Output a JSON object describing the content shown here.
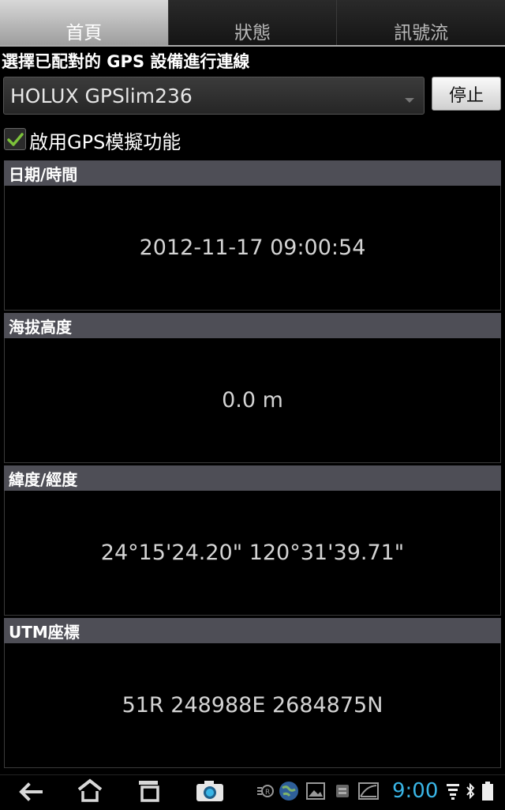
{
  "tabs": [
    {
      "label": "首頁",
      "active": true
    },
    {
      "label": "狀態",
      "active": false
    },
    {
      "label": "訊號流",
      "active": false
    }
  ],
  "connect": {
    "prompt": "選擇已配對的 GPS 設備進行連線",
    "device": "HOLUX GPSlim236",
    "stop_label": "停止"
  },
  "simulation": {
    "label": "啟用GPS模擬功能",
    "checked": true
  },
  "sections": {
    "datetime": {
      "header": "日期/時間",
      "value": "2012-11-17 09:00:54"
    },
    "altitude": {
      "header": "海拔高度",
      "value": "0.0 m"
    },
    "latlon": {
      "header": "緯度/經度",
      "value": "24°15'24.20\" 120°31'39.71\""
    },
    "utm": {
      "header": "UTM座標",
      "value": "51R 248988E 2684875N"
    }
  },
  "status_bar": {
    "time": "9:00"
  },
  "colors": {
    "accent": "#39b5e6",
    "check": "#7cc23a",
    "section_header": "#4e4e56"
  }
}
